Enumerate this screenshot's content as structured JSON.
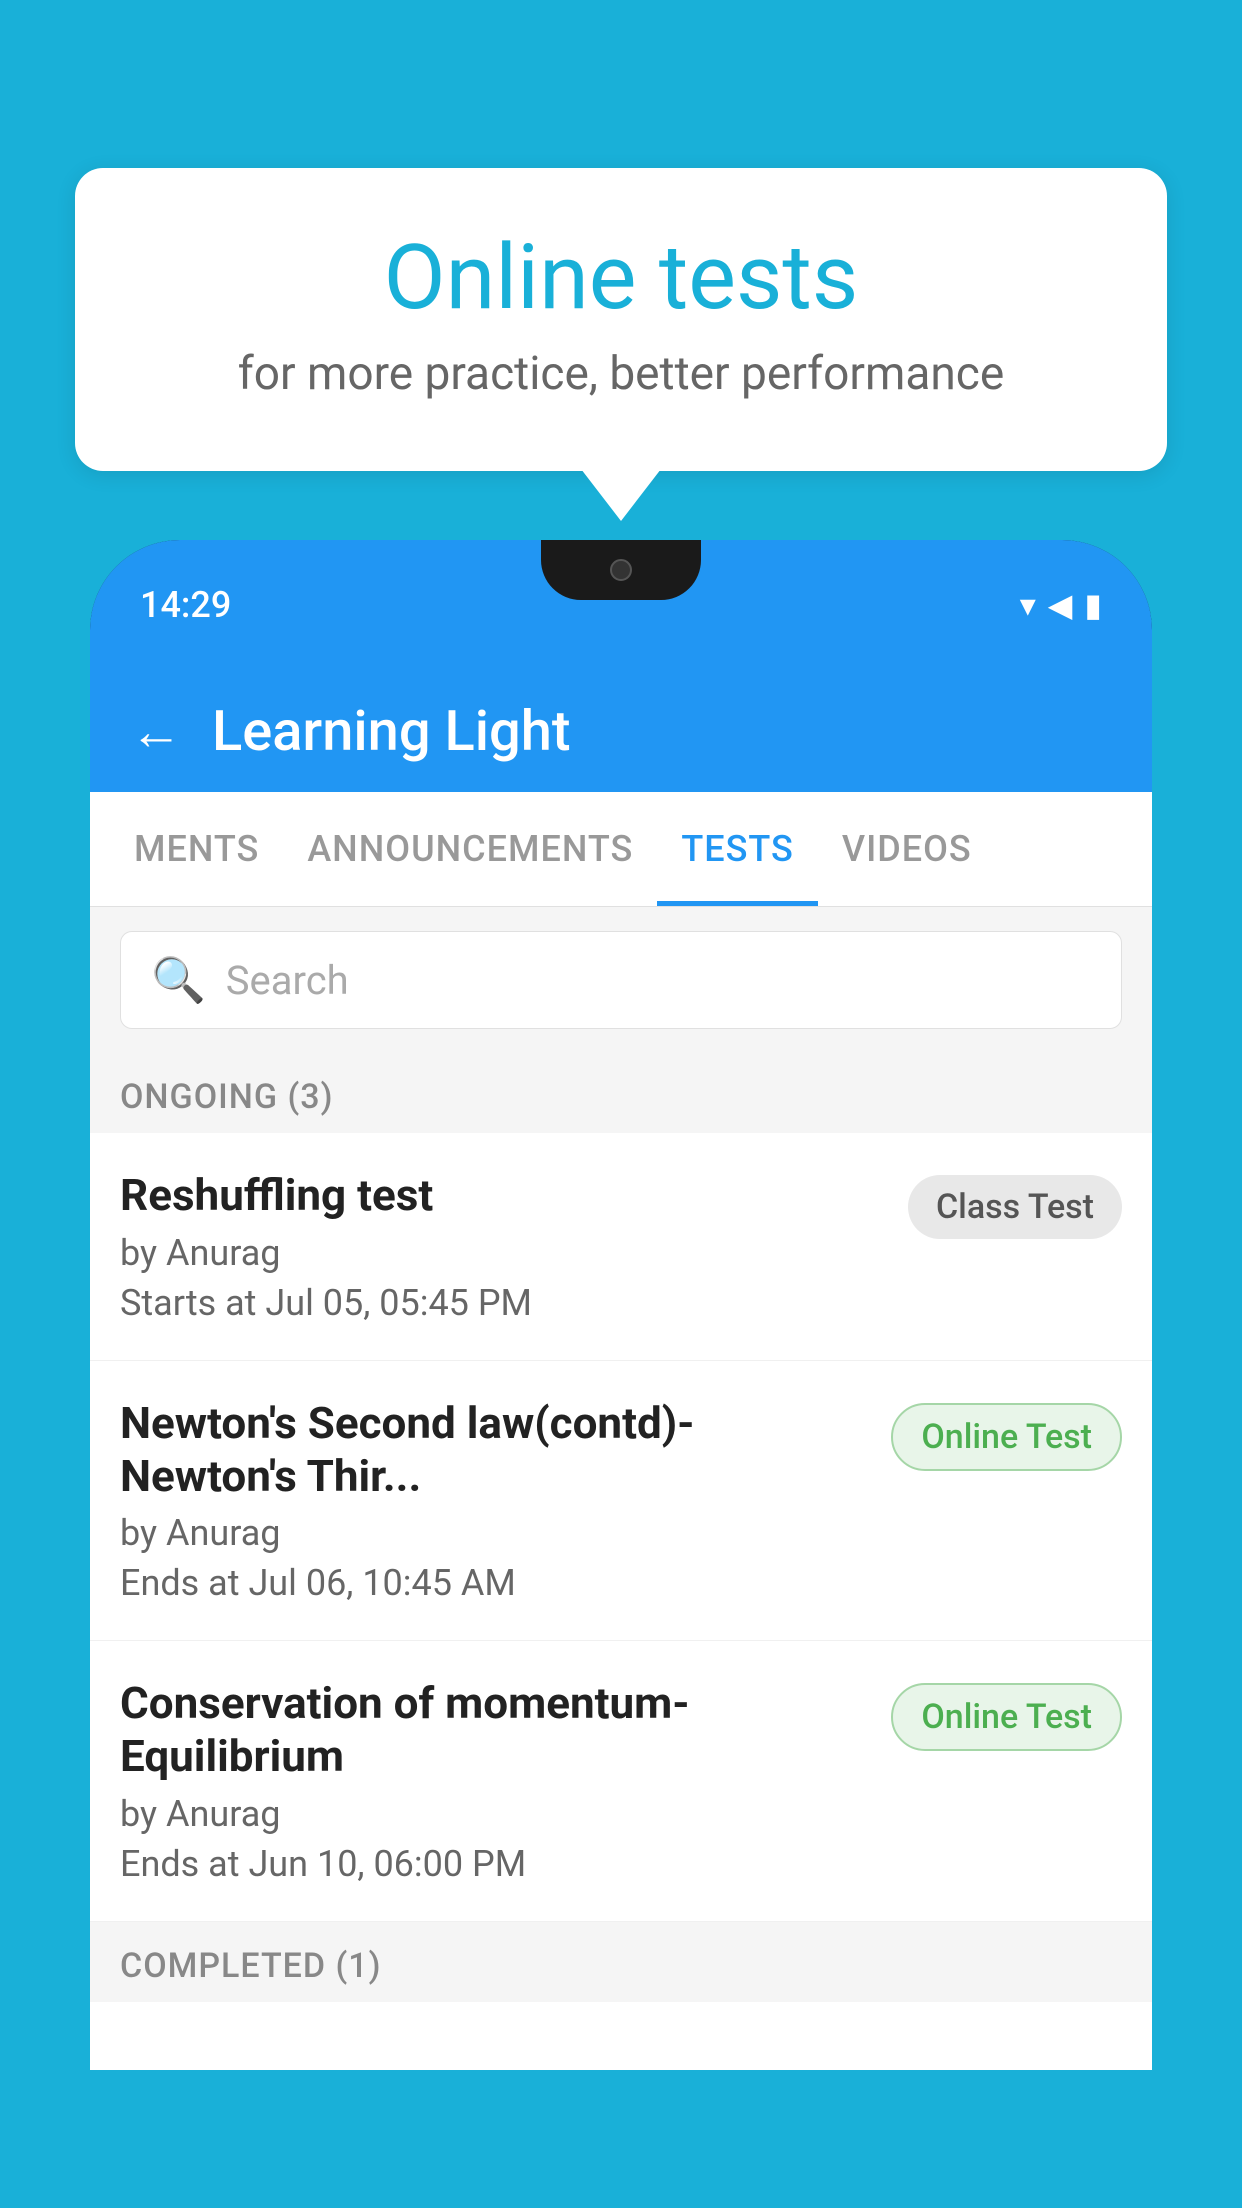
{
  "background": {
    "color": "#19b0d8"
  },
  "bubble": {
    "title": "Online tests",
    "subtitle": "for more practice, better performance"
  },
  "phone": {
    "statusBar": {
      "time": "14:29"
    },
    "appBar": {
      "title": "Learning Light",
      "backLabel": "←"
    },
    "tabs": [
      {
        "label": "MENTS",
        "active": false
      },
      {
        "label": "ANNOUNCEMENTS",
        "active": false
      },
      {
        "label": "TESTS",
        "active": true
      },
      {
        "label": "VIDEOS",
        "active": false
      }
    ],
    "search": {
      "placeholder": "Search"
    },
    "ongoingSection": {
      "title": "ONGOING (3)"
    },
    "tests": [
      {
        "name": "Reshuffling test",
        "author": "by Anurag",
        "time": "Starts at  Jul 05, 05:45 PM",
        "badge": "Class Test",
        "badgeType": "class"
      },
      {
        "name": "Newton's Second law(contd)-Newton's Thir...",
        "author": "by Anurag",
        "time": "Ends at  Jul 06, 10:45 AM",
        "badge": "Online Test",
        "badgeType": "online"
      },
      {
        "name": "Conservation of momentum-Equilibrium",
        "author": "by Anurag",
        "time": "Ends at  Jun 10, 06:00 PM",
        "badge": "Online Test",
        "badgeType": "online"
      }
    ],
    "completedSection": {
      "title": "COMPLETED (1)"
    }
  }
}
